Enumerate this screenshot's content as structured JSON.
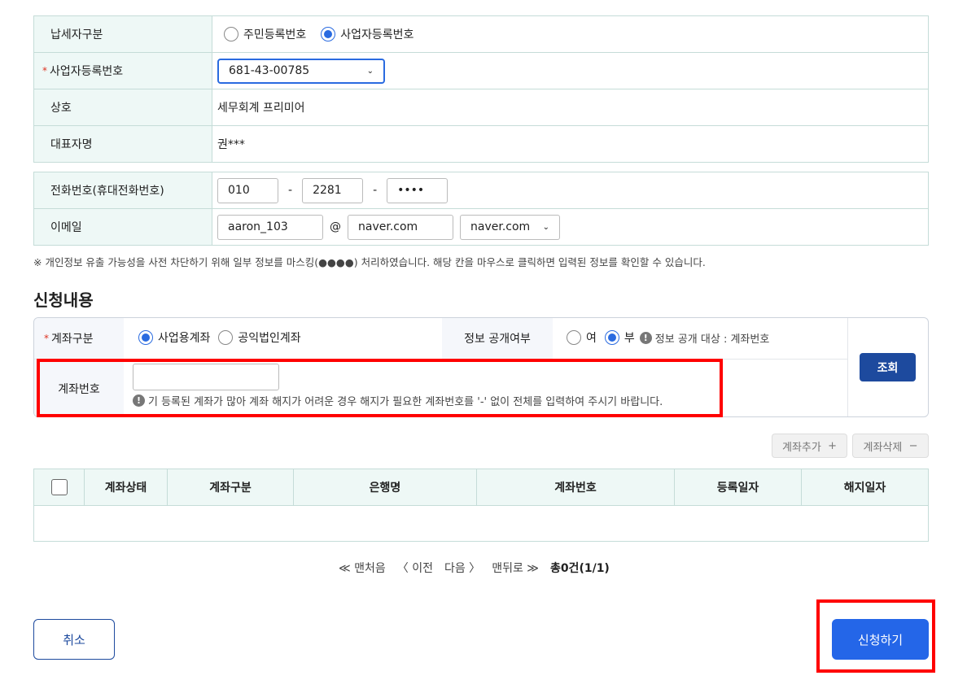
{
  "taxpayer": {
    "type_label": "납세자구분",
    "type_options": [
      "주민등록번호",
      "사업자등록번호"
    ],
    "type_selected": "사업자등록번호",
    "brn_label": "사업자등록번호",
    "brn_value": "681-43-00785",
    "name_label": "상호",
    "name_value": "세무회계 프리미어",
    "rep_label": "대표자명",
    "rep_value": "권***",
    "phone_label": "전화번호(휴대전화번호)",
    "phone": [
      "010",
      "2281",
      "••••"
    ],
    "dash": "-",
    "email_label": "이메일",
    "email_id": "aaron_103",
    "at": "@",
    "email_domain": "naver.com",
    "email_domain_select": "naver.com"
  },
  "mask_note": "※ 개인정보 유출 가능성을 사전 차단하기 위해 일부 정보를 마스킹(●●●●) 처리하였습니다. 해당 칸을 마우스로 클릭하면 입력된 정보를 확인할 수 있습니다.",
  "application": {
    "heading": "신청내용",
    "acct_type_label": "계좌구분",
    "acct_type_options": [
      "사업용계좌",
      "공익법인계좌"
    ],
    "acct_type_selected": "사업용계좌",
    "disclose_label": "정보 공개여부",
    "disclose_options": [
      "여",
      "부"
    ],
    "disclose_selected": "부",
    "disclose_note": "정보 공개 대상 : 계좌번호",
    "acct_no_label": "계좌번호",
    "acct_no_value": "",
    "acct_no_note": "기 등록된 계좌가 많아 계좌 해지가 어려운 경우 해지가 필요한 계좌번호를 '-' 없이 전체를 입력하여 주시기 바랍니다.",
    "search_btn": "조회",
    "add_btn": "계좌추가",
    "delete_btn": "계좌삭제"
  },
  "table": {
    "columns": [
      "계좌상태",
      "계좌구분",
      "은행명",
      "계좌번호",
      "등록일자",
      "해지일자"
    ],
    "rows": []
  },
  "pagination": {
    "first": "맨처음",
    "prev": "이전",
    "next": "다음",
    "last": "맨뒤로",
    "total": "총0건(1/1)"
  },
  "footer": {
    "cancel": "취소",
    "submit": "신청하기"
  },
  "colors": {
    "primary": "#2466e8",
    "navy": "#1d4a9e",
    "highlight": "#ff0000",
    "label_bg": "#eef8f6"
  }
}
